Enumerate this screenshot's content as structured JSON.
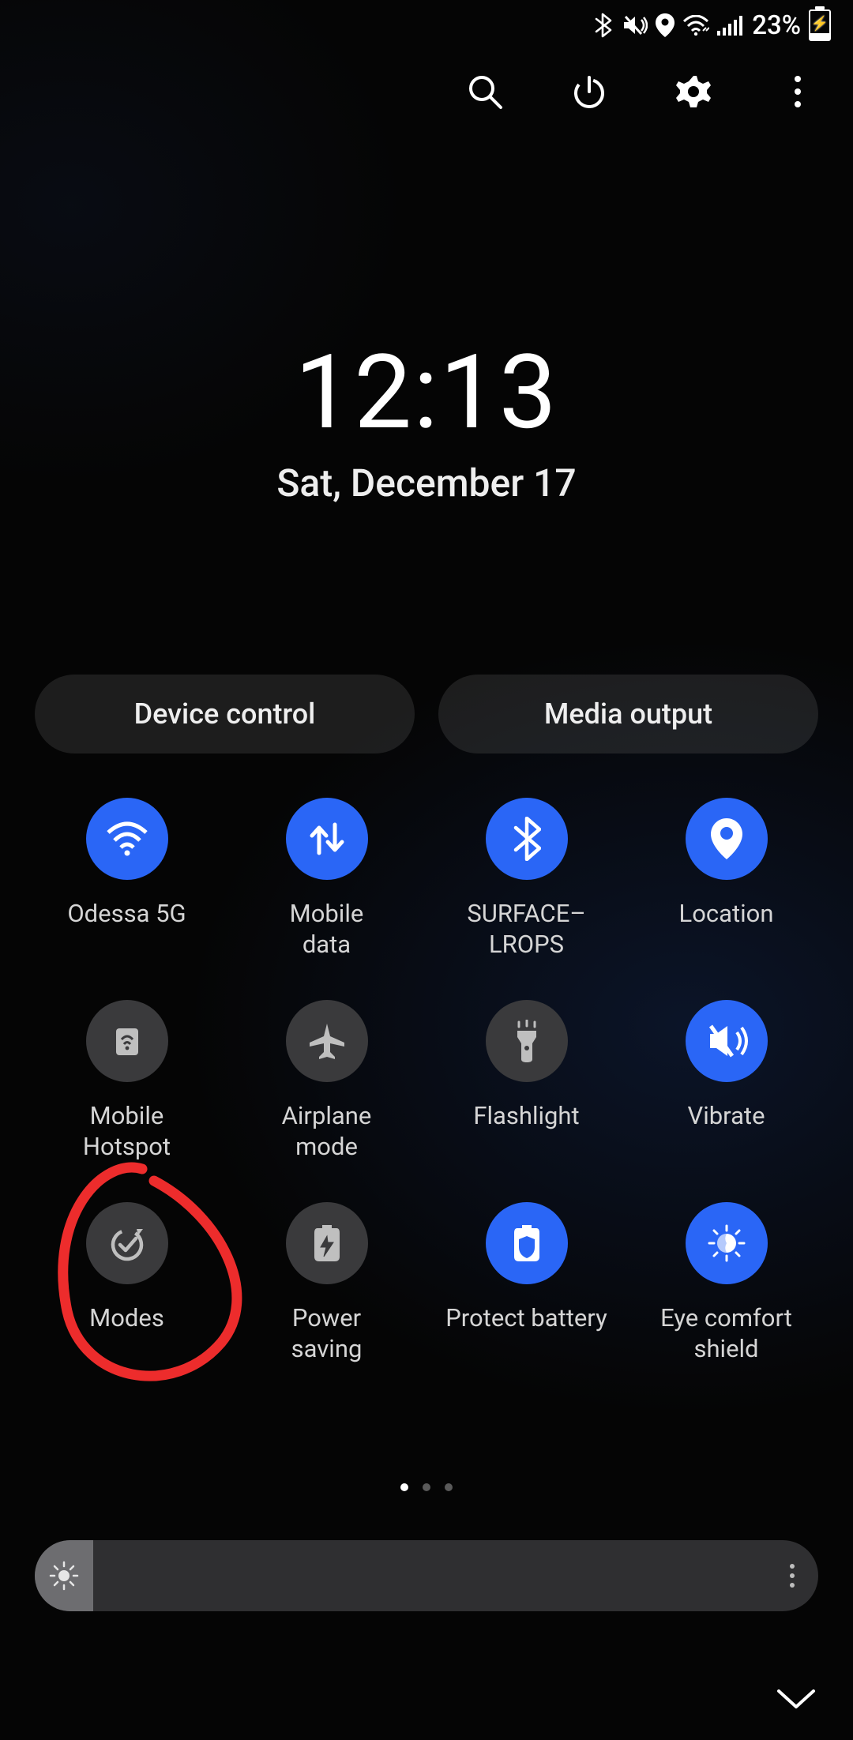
{
  "status": {
    "battery_percent": "23%"
  },
  "actions": {},
  "clock": {
    "time": "12:13",
    "date": "Sat, December 17"
  },
  "pills": {
    "device_control": "Device control",
    "media_output": "Media output"
  },
  "tiles": [
    {
      "id": "wifi",
      "label": "Odessa 5G",
      "on": true,
      "icon": "wifi"
    },
    {
      "id": "mobile-data",
      "label": "Mobile\ndata",
      "on": true,
      "icon": "mobile-data"
    },
    {
      "id": "bluetooth",
      "label": "SURFACE–LROPS",
      "on": true,
      "icon": "bluetooth"
    },
    {
      "id": "location",
      "label": "Location",
      "on": true,
      "icon": "location"
    },
    {
      "id": "hotspot",
      "label": "Mobile\nHotspot",
      "on": false,
      "icon": "hotspot"
    },
    {
      "id": "airplane",
      "label": "Airplane\nmode",
      "on": false,
      "icon": "airplane"
    },
    {
      "id": "flashlight",
      "label": "Flashlight",
      "on": false,
      "icon": "flashlight"
    },
    {
      "id": "vibrate",
      "label": "Vibrate",
      "on": true,
      "icon": "vibrate"
    },
    {
      "id": "modes",
      "label": "Modes",
      "on": false,
      "icon": "modes"
    },
    {
      "id": "power-saving",
      "label": "Power\nsaving",
      "on": false,
      "icon": "power-saving"
    },
    {
      "id": "protect-battery",
      "label": "Protect battery",
      "on": true,
      "icon": "protect-battery"
    },
    {
      "id": "eye-comfort",
      "label": "Eye comfort\nshield",
      "on": true,
      "icon": "eye-comfort"
    }
  ],
  "pages": {
    "count": 3,
    "active": 0
  },
  "brightness": {
    "value_percent": 7
  },
  "annotation": {
    "circled_tile": "modes",
    "color": "#ed2c2c"
  }
}
